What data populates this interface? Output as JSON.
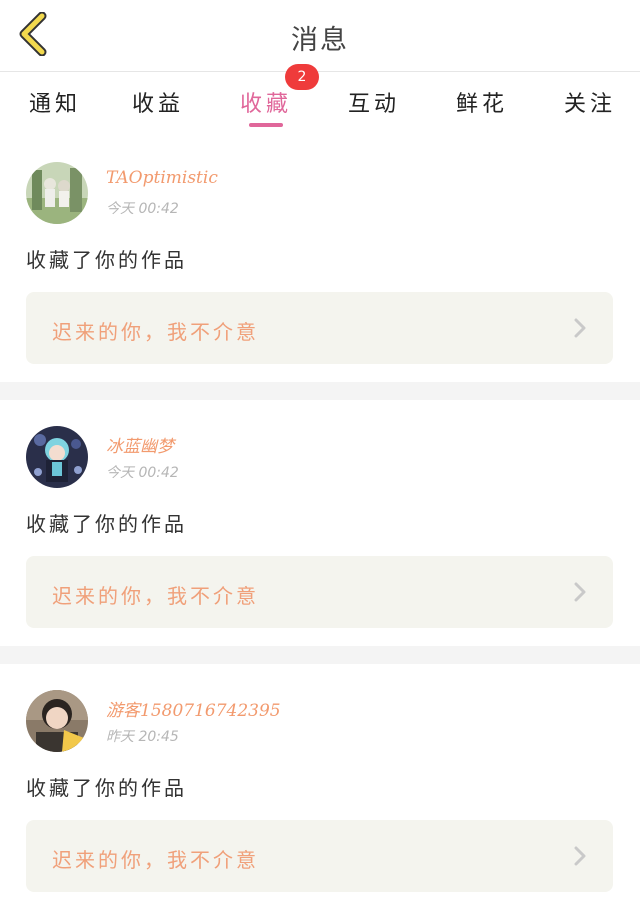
{
  "header": {
    "title": "消息"
  },
  "tabs": [
    {
      "label": "通知"
    },
    {
      "label": "收益"
    },
    {
      "label": "收藏"
    },
    {
      "label": "互动"
    },
    {
      "label": "鲜花"
    },
    {
      "label": "关注"
    }
  ],
  "active_tab": "收藏",
  "tab_badge": "2",
  "messages": [
    {
      "username": "TAOptimistic",
      "time": "今天 00:42",
      "action": "收藏了你的作品",
      "work_title": "迟来的你，我不介意"
    },
    {
      "username": "冰蓝幽梦",
      "time": "今天 00:42",
      "action": "收藏了你的作品",
      "work_title": "迟来的你，我不介意"
    },
    {
      "username": "游客1580716742395",
      "time": "昨天 20:45",
      "action": "收藏了你的作品",
      "work_title": "迟来的你，我不介意"
    }
  ],
  "colors": {
    "accent": "#e0679a",
    "badge": "#ef3b3b",
    "username": "#f29a6e",
    "work_card_bg": "#f4f4ee",
    "back_icon": "#f2d94e"
  },
  "icons": {
    "back": "chevron-left-icon",
    "card_arrow": "chevron-right-icon"
  }
}
